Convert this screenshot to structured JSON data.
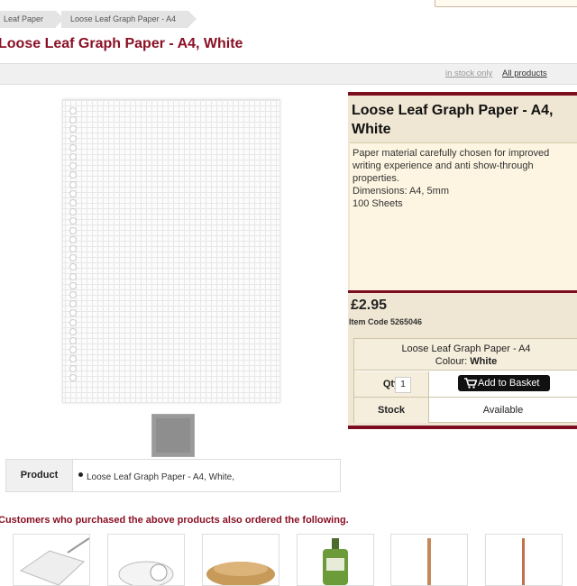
{
  "breadcrumb": [
    "Leaf Paper",
    "Loose Leaf Graph Paper - A4"
  ],
  "page_title": "Loose Leaf Graph Paper - A4, White",
  "filters": {
    "in_stock": "in stock only",
    "all": "All products"
  },
  "product": {
    "title": "Loose Leaf Graph Paper - A4, White",
    "description": [
      "Paper material carefully chosen for improved",
      "writing experience and anti show-through",
      "properties.",
      "Dimensions: A4, 5mm",
      "100 Sheets"
    ],
    "price": "£2.95",
    "item_code": "Item Code 5265046"
  },
  "purchase": {
    "variant": "Loose Leaf Graph Paper - A4",
    "colour_label": "Colour:",
    "colour_value": "White",
    "qty_label": "Qty",
    "qty_value": "1",
    "add_button": "Add to Basket",
    "stock_label": "Stock",
    "stock_value": "Available"
  },
  "spec_table": {
    "header": "Product",
    "value": "Loose Leaf Graph Paper - A4, White,"
  },
  "related": {
    "heading": "Customers who purchased the above products also ordered the following."
  },
  "colors": {
    "brand": "#8a1025",
    "panel": "#efe7d4"
  }
}
